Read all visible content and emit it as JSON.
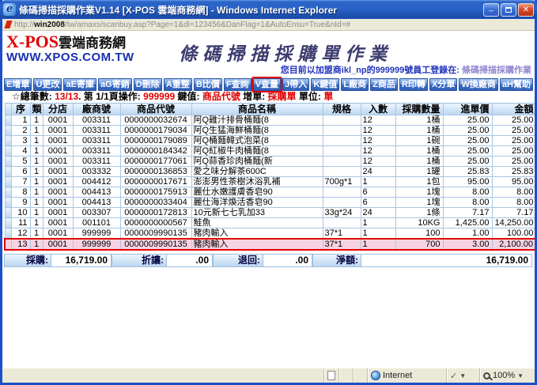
{
  "window": {
    "title": "條碼掃描採購作業V1.14 [X-POS 雲端商務網] - Windows Internet Explorer",
    "minimize_glyph": "_",
    "close_glyph": "✕",
    "ie_glyph": "e",
    "url_prefix": "http://",
    "url_host": "win2008",
    "url_rest": "/tw/amaxs/scanbuy.asp?Page=1&dl=123456&DanFlag=1&AutoEnsu=True&nId=#"
  },
  "header": {
    "logo_main": "X-POS",
    "logo_suffix": "雲端商務網",
    "logo_url": "WWW.XPOS.COM.TW",
    "page_title": "條碼掃描採購單作業",
    "login_prefix": "您目前以加盟商ikl_np的999999號員工登錄在: ",
    "login_module": "條碼掃描採購作業"
  },
  "toolbar": {
    "buttons": [
      {
        "label": "E增單",
        "highlight": false
      },
      {
        "label": "U更改",
        "highlight": false
      },
      {
        "label": "aE寄庫",
        "highlight": false
      },
      {
        "label": "aG寄銷",
        "highlight": false
      },
      {
        "label": "D刪除",
        "highlight": false
      },
      {
        "label": "A重整",
        "highlight": false
      },
      {
        "label": "B比價",
        "highlight": false
      },
      {
        "label": "F查詢",
        "highlight": false
      },
      {
        "label": "V查量",
        "highlight": true
      },
      {
        "label": "J帶入",
        "highlight": false
      },
      {
        "label": "K鍵值",
        "highlight": false
      },
      {
        "label": "L廠商",
        "highlight": false
      },
      {
        "label": "Z商品",
        "highlight": false
      },
      {
        "label": "R印轉",
        "highlight": false
      },
      {
        "label": "X分單",
        "highlight": false
      },
      {
        "label": "W換廠商",
        "highlight": false
      },
      {
        "label": "aH幫助",
        "highlight": false
      }
    ]
  },
  "status_row": {
    "segments": [
      {
        "text": "☆總筆數: ",
        "red": false
      },
      {
        "text": "13/13",
        "red": true
      },
      {
        "text": ". 第 1/1頁操作:  ",
        "red": false
      },
      {
        "text": "999999",
        "red": true
      },
      {
        "text": "  鍵值: ",
        "red": false
      },
      {
        "text": "商品代號",
        "red": true
      },
      {
        "text": "  增單: ",
        "red": false
      },
      {
        "text": "採購單",
        "red": true
      },
      {
        "text": " 單位: ",
        "red": false
      },
      {
        "text": "單",
        "red": true
      }
    ]
  },
  "table": {
    "headers": [
      "序",
      "類",
      "分店",
      "廠商號",
      "商品代號",
      "商品名稱",
      "規格",
      "入數",
      "採購數量",
      "進單價",
      "金額"
    ],
    "rows": [
      {
        "c": [
          "1",
          "1",
          "0001",
          "003311",
          "0000000032674",
          "阿Q雞汁排骨桶麵(8",
          "",
          "12",
          "1桶",
          "25.00",
          "25.00"
        ],
        "hl": false
      },
      {
        "c": [
          "2",
          "1",
          "0001",
          "003311",
          "0000000179034",
          "阿Q生猛海鮮桶麵(8",
          "",
          "12",
          "1桶",
          "25.00",
          "25.00"
        ],
        "hl": false
      },
      {
        "c": [
          "3",
          "1",
          "0001",
          "003311",
          "0000000179089",
          "阿Q桶麵韓式泡菜(8",
          "",
          "12",
          "1碗",
          "25.00",
          "25.00"
        ],
        "hl": false
      },
      {
        "c": [
          "4",
          "1",
          "0001",
          "003311",
          "0000000184342",
          "阿Q紅椒牛肉桶麵(8",
          "",
          "12",
          "1桶",
          "25.00",
          "25.00"
        ],
        "hl": false
      },
      {
        "c": [
          "5",
          "1",
          "0001",
          "003311",
          "0000000177061",
          "阿Q蒜香珍肉桶麵(新",
          "",
          "12",
          "1桶",
          "25.00",
          "25.00"
        ],
        "hl": false
      },
      {
        "c": [
          "6",
          "1",
          "0001",
          "003332",
          "0000000136853",
          "愛之味分解茶600C",
          "",
          "24",
          "1罐",
          "25.83",
          "25.83"
        ],
        "hl": false
      },
      {
        "c": [
          "7",
          "1",
          "0001",
          "004412",
          "0000000017671",
          "澎澎男性茶樹沐浴乳補",
          "700g*1",
          "1",
          "1包",
          "95.00",
          "95.00"
        ],
        "hl": false
      },
      {
        "c": [
          "8",
          "1",
          "0001",
          "004413",
          "0000000175913",
          "麗仕水嫩護膚香皂90",
          "",
          "6",
          "1塊",
          "8.00",
          "8.00"
        ],
        "hl": false
      },
      {
        "c": [
          "9",
          "1",
          "0001",
          "004413",
          "0000000033404",
          "麗仕海洋煥活香皂90",
          "",
          "6",
          "1塊",
          "8.00",
          "8.00"
        ],
        "hl": false
      },
      {
        "c": [
          "10",
          "1",
          "0001",
          "003307",
          "0000000172813",
          "10元新七七乳加33",
          "33g*24",
          "24",
          "1條",
          "7.17",
          "7.17"
        ],
        "hl": false
      },
      {
        "c": [
          "11",
          "1",
          "0001",
          "001101",
          "0000000000567",
          "鮭魚",
          "",
          "1",
          "10KG",
          "1,425.00",
          "14,250.00"
        ],
        "hl": false
      },
      {
        "c": [
          "12",
          "1",
          "0001",
          "999999",
          "0000009990135",
          "豬肉輸入",
          "37*1",
          "1",
          "100",
          "1.00",
          "100.00"
        ],
        "hl": false
      },
      {
        "c": [
          "13",
          "1",
          "0001",
          "999999",
          "0000009990135",
          "豬肉輸入",
          "37*1",
          "1",
          "700",
          "3.00",
          "2,100.00"
        ],
        "hl": true
      }
    ]
  },
  "totals": {
    "items": [
      {
        "label": "採購:",
        "value": "16,719.00"
      },
      {
        "label": "折讓:",
        "value": ".00"
      },
      {
        "label": "退回:",
        "value": ".00"
      },
      {
        "label": "淨額:",
        "value": "16,719.00"
      }
    ]
  },
  "statusbar": {
    "internet_label": "Internet",
    "zoom_label": "100%",
    "check_glyph": "✓",
    "dropdown_glyph": "▼"
  },
  "colors": {
    "accent_red": "#e00000",
    "highlight_pink": "#f7d3e1",
    "titlebar_blue": "#2a64c8"
  }
}
